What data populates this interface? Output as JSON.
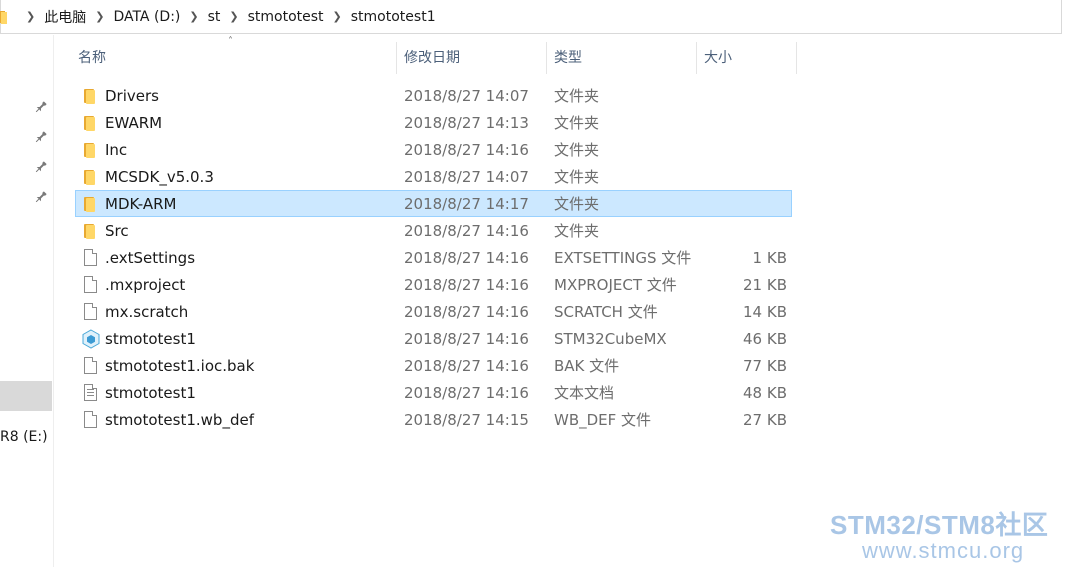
{
  "address_bar": {
    "breadcrumbs": [
      "此电脑",
      "DATA (D:)",
      "st",
      "stmototest",
      "stmototest1"
    ],
    "separator_icon": "chevron-right-icon"
  },
  "nav_pane": {
    "drive_label": "R8 (E:)",
    "pin_icon": "pin-icon"
  },
  "columns": {
    "name": "名称",
    "date": "修改日期",
    "type": "类型",
    "size": "大小"
  },
  "files": [
    {
      "name": "Drivers",
      "date": "2018/8/27 14:07",
      "type": "文件夹",
      "size": "",
      "icon": "folder-icon",
      "selected": false
    },
    {
      "name": "EWARM",
      "date": "2018/8/27 14:13",
      "type": "文件夹",
      "size": "",
      "icon": "folder-icon",
      "selected": false
    },
    {
      "name": "Inc",
      "date": "2018/8/27 14:16",
      "type": "文件夹",
      "size": "",
      "icon": "folder-icon",
      "selected": false
    },
    {
      "name": "MCSDK_v5.0.3",
      "date": "2018/8/27 14:07",
      "type": "文件夹",
      "size": "",
      "icon": "folder-icon",
      "selected": false
    },
    {
      "name": "MDK-ARM",
      "date": "2018/8/27 14:17",
      "type": "文件夹",
      "size": "",
      "icon": "folder-icon",
      "selected": true
    },
    {
      "name": "Src",
      "date": "2018/8/27 14:16",
      "type": "文件夹",
      "size": "",
      "icon": "folder-icon",
      "selected": false
    },
    {
      "name": ".extSettings",
      "date": "2018/8/27 14:16",
      "type": "EXTSETTINGS 文件",
      "size": "1 KB",
      "icon": "file-icon",
      "selected": false
    },
    {
      "name": ".mxproject",
      "date": "2018/8/27 14:16",
      "type": "MXPROJECT 文件",
      "size": "21 KB",
      "icon": "file-icon",
      "selected": false
    },
    {
      "name": "mx.scratch",
      "date": "2018/8/27 14:16",
      "type": "SCRATCH 文件",
      "size": "14 KB",
      "icon": "file-icon",
      "selected": false
    },
    {
      "name": "stmototest1",
      "date": "2018/8/27 14:16",
      "type": "STM32CubeMX",
      "size": "46 KB",
      "icon": "cube-icon",
      "selected": false
    },
    {
      "name": "stmototest1.ioc.bak",
      "date": "2018/8/27 14:16",
      "type": "BAK 文件",
      "size": "77 KB",
      "icon": "file-icon",
      "selected": false
    },
    {
      "name": "stmototest1",
      "date": "2018/8/27 14:16",
      "type": "文本文档",
      "size": "48 KB",
      "icon": "text-file-icon",
      "selected": false
    },
    {
      "name": "stmototest1.wb_def",
      "date": "2018/8/27 14:15",
      "type": "WB_DEF 文件",
      "size": "27 KB",
      "icon": "file-icon",
      "selected": false
    }
  ],
  "watermark": {
    "title": "STM32/STM8社区",
    "url": "www.stmcu.org"
  },
  "colors": {
    "selection_bg": "#cce8ff",
    "selection_border": "#99d1ff",
    "folder": "#ffd767",
    "watermark": "#a9c6e6"
  }
}
